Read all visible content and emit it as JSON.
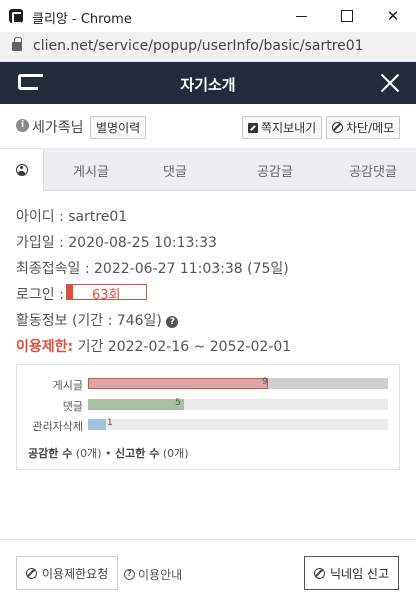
{
  "window": {
    "title": "클리앙 - Chrome",
    "url": "clien.net/service/popup/userInfo/basic/sartre01"
  },
  "header": {
    "title": "자기소개"
  },
  "user": {
    "nickname": "세가족님",
    "history_label": "별명이력",
    "message_label": "쪽지보내기",
    "block_label": "차단/메모"
  },
  "tabs": [
    "게시글",
    "댓글",
    "공감글",
    "공감댓글"
  ],
  "info": {
    "id_line": "아이디 : sartre01",
    "join_line": "가입일 : 2020-08-25 10:13:33",
    "last_line": "최종접속일 : 2022-06-27 11:03:38 (75일)",
    "login_label": "로그인 :",
    "login_count": "63회",
    "login_fill": 0.08,
    "activity_line": "활동정보 (기간 : 746일)",
    "restrict_label": "이용제한:",
    "restrict_value": " 기간 2022-02-16 ~ 2052-02-01"
  },
  "stats": {
    "rows": [
      {
        "label": "게시글",
        "value": "9",
        "fill": 0.6,
        "color": "#d8a8a8",
        "bg": "#cfcfcf"
      },
      {
        "label": "댓글",
        "value": "5",
        "fill": 0.32,
        "color": "#a8bfa3",
        "bg": "#ebebeb"
      },
      {
        "label": "관리자삭제",
        "value": "1",
        "fill": 0.06,
        "color": "#9fc2da",
        "bg": "#ebebeb"
      }
    ],
    "empathy_label": "공감한 수",
    "empathy_value": "(0개)",
    "report_label": "신고한 수",
    "report_value": "(0개)"
  },
  "footer": {
    "request_label": "이용제한요청",
    "guide_label": "이용안내",
    "report_label": "닉네임 신고"
  }
}
